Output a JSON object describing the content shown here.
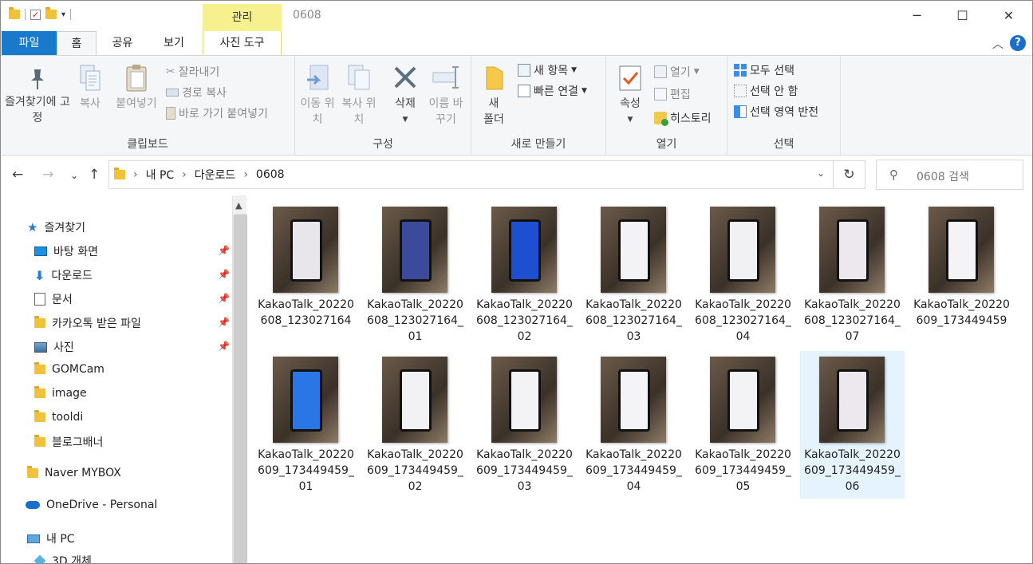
{
  "titlebar": {
    "context_tab": "관리",
    "title": "0608",
    "minimize": "─",
    "maximize": "☐",
    "close": "✕"
  },
  "tabs": {
    "file": "파일",
    "home": "홈",
    "share": "공유",
    "view": "보기",
    "picture_tools": "사진 도구"
  },
  "ribbon": {
    "clipboard": {
      "pin": "즐겨찾기에 고정",
      "copy": "복사",
      "paste": "붙여넣기",
      "cut": "잘라내기",
      "copy_path": "경로 복사",
      "paste_shortcut": "바로 가기 붙여넣기",
      "label": "클립보드"
    },
    "organize": {
      "move_to": "이동 위치",
      "copy_to": "복사 위치",
      "delete": "삭제",
      "rename": "이름 바꾸기",
      "label": "구성"
    },
    "new": {
      "new_folder": "새 폴더",
      "new_item": "새 항목",
      "easy_access": "빠른 연결",
      "label": "새로 만들기"
    },
    "open": {
      "properties": "속성",
      "open": "열기",
      "edit": "편집",
      "history": "히스토리",
      "label": "열기"
    },
    "select": {
      "select_all": "모두 선택",
      "select_none": "선택 안 함",
      "invert": "선택 영역 반전",
      "label": "선택"
    }
  },
  "address": {
    "crumbs": [
      "내 PC",
      "다운로드",
      "0608"
    ],
    "search_placeholder": "0608 검색"
  },
  "nav": {
    "quick_access": "즐겨찾기",
    "items": [
      {
        "label": "바탕 화면",
        "pinned": true
      },
      {
        "label": "다운로드",
        "pinned": true
      },
      {
        "label": "문서",
        "pinned": true
      },
      {
        "label": "카카오톡 받은 파일",
        "pinned": true
      },
      {
        "label": "사진",
        "pinned": true
      },
      {
        "label": "GOMCam",
        "pinned": false
      },
      {
        "label": "image",
        "pinned": false
      },
      {
        "label": "tooldi",
        "pinned": false
      },
      {
        "label": "블로그배너",
        "pinned": false
      }
    ],
    "naver": "Naver MYBOX",
    "onedrive": "OneDrive - Personal",
    "this_pc": "내 PC",
    "objects_3d": "3D 개체"
  },
  "files": [
    {
      "name": "KakaoTalk_20220608_123027164",
      "screen": "#e8e6ea",
      "selected": false
    },
    {
      "name": "KakaoTalk_20220608_123027164_01",
      "screen": "#3b4a9a",
      "selected": false
    },
    {
      "name": "KakaoTalk_20220608_123027164_02",
      "screen": "#1e4fd0",
      "selected": false
    },
    {
      "name": "KakaoTalk_20220608_123027164_03",
      "screen": "#f3f3f5",
      "selected": false
    },
    {
      "name": "KakaoTalk_20220608_123027164_04",
      "screen": "#f1f1f3",
      "selected": false
    },
    {
      "name": "KakaoTalk_20220608_123027164_07",
      "screen": "#ece8ee",
      "selected": false
    },
    {
      "name": "KakaoTalk_20220609_173449459",
      "screen": "#f4f4f6",
      "selected": false
    },
    {
      "name": "KakaoTalk_20220609_173449459_01",
      "screen": "#2b76e6",
      "selected": false
    },
    {
      "name": "KakaoTalk_20220609_173449459_02",
      "screen": "#f2f2f4",
      "selected": false
    },
    {
      "name": "KakaoTalk_20220609_173449459_03",
      "screen": "#f3f3f5",
      "selected": false
    },
    {
      "name": "KakaoTalk_20220609_173449459_04",
      "screen": "#f4f4f6",
      "selected": false
    },
    {
      "name": "KakaoTalk_20220609_173449459_05",
      "screen": "#f3f3f6",
      "selected": false
    },
    {
      "name": "KakaoTalk_20220609_173449459_06",
      "screen": "#ece8ee",
      "selected": true
    }
  ],
  "colors": {
    "accent": "#1979ca",
    "context_tab": "#f6f08f",
    "selection": "#e5f3ff"
  }
}
